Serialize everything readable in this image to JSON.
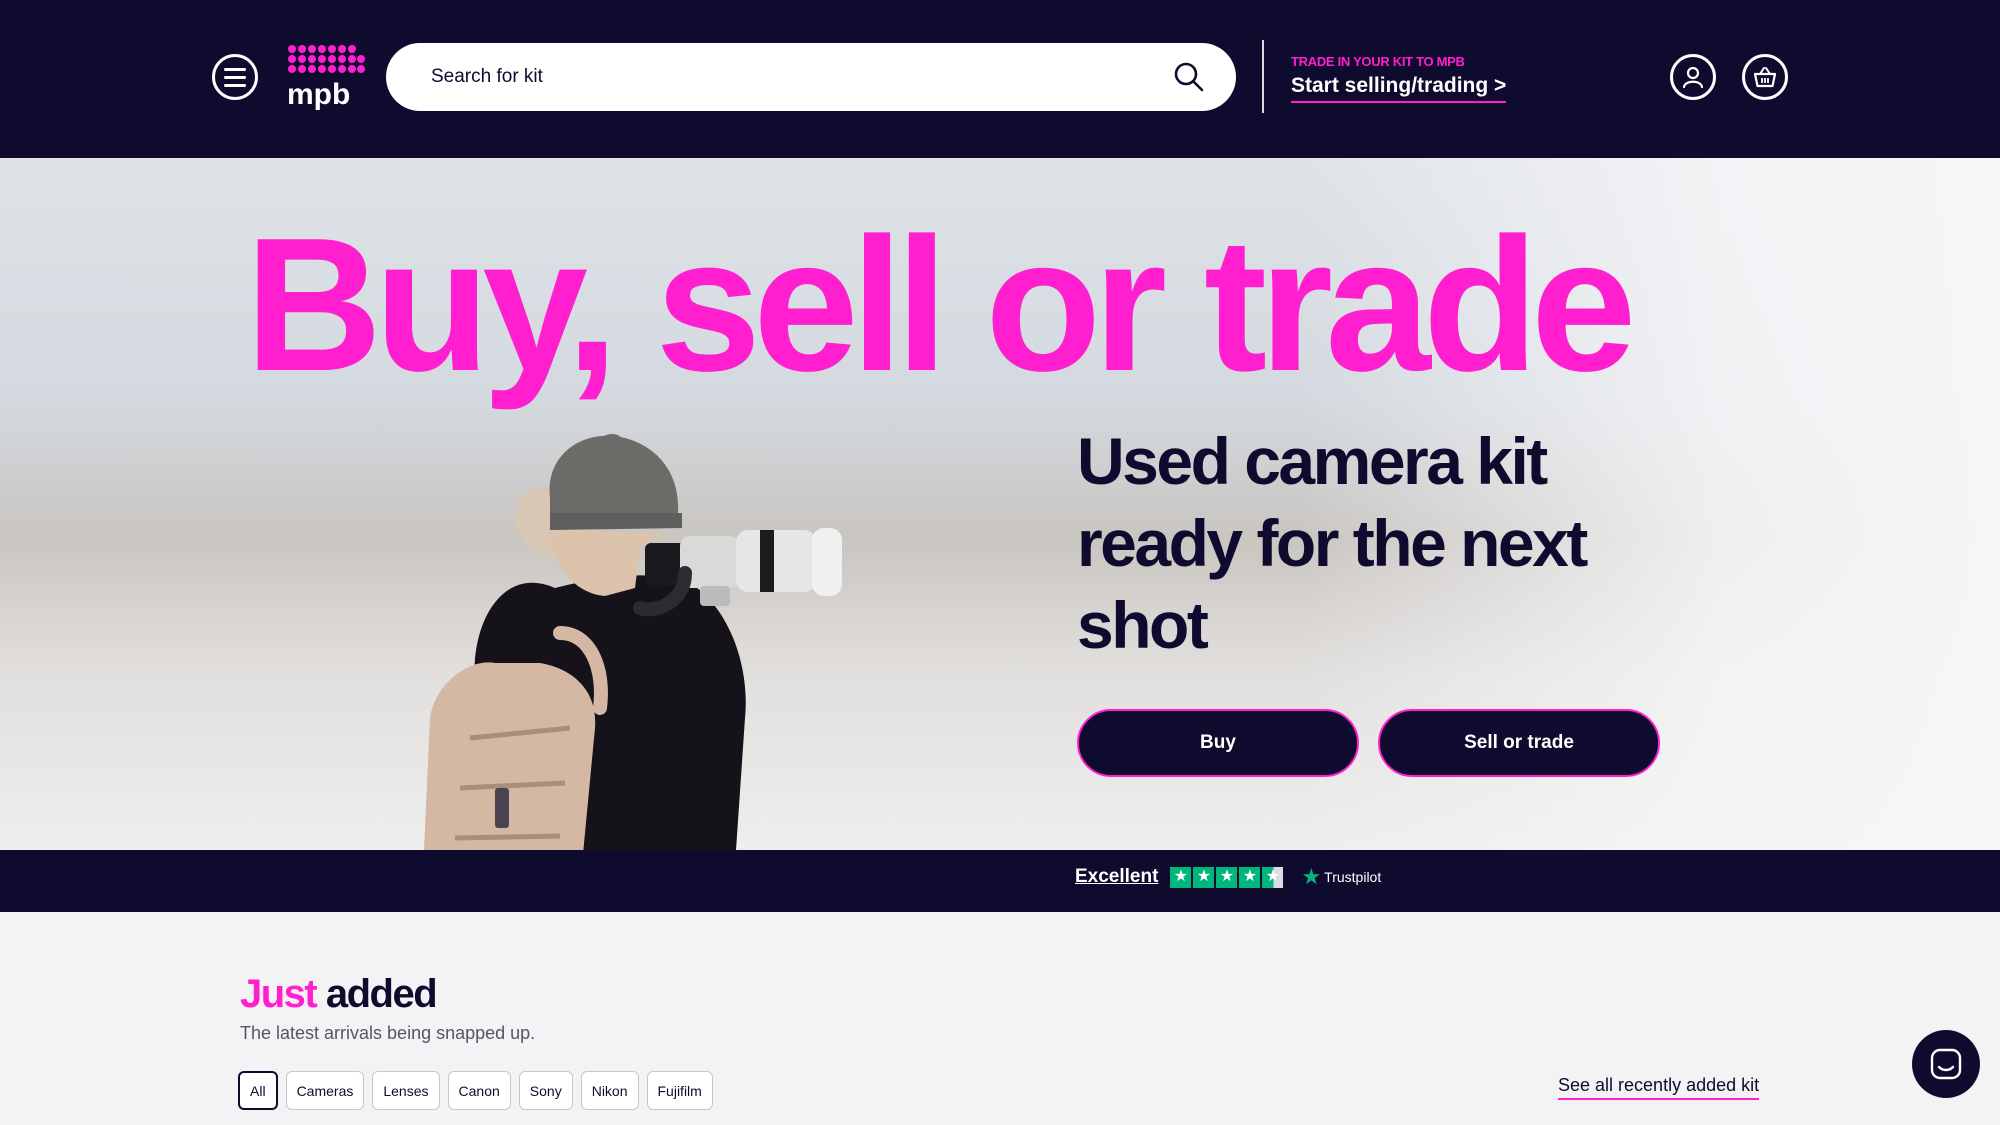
{
  "header": {
    "search_placeholder": "Search for kit",
    "trade_kicker": "TRADE IN YOUR KIT TO MPB",
    "trade_link": "Start selling/trading >",
    "logo_text": "mpb"
  },
  "hero": {
    "title": "Buy, sell or trade",
    "subtitle": "Used camera kit ready for the next shot",
    "buy_label": "Buy",
    "sell_label": "Sell or trade"
  },
  "trust": {
    "rating_label": "Excellent",
    "stars_filled": 4.5,
    "stars_max": 5,
    "brand": "Trustpilot"
  },
  "just_added": {
    "title_accent": "Just",
    "title_rest": "added",
    "subtitle": "The latest arrivals being snapped up.",
    "filters": [
      "All",
      "Cameras",
      "Lenses",
      "Canon",
      "Sony",
      "Nikon",
      "Fujifilm"
    ],
    "active_filter": "All",
    "see_all": "See all recently added kit"
  },
  "colors": {
    "navy": "#0f0b2e",
    "brand_pink": "#ff1fcf",
    "trustpilot_green": "#00b67a"
  },
  "icons": [
    "menu-icon",
    "mpb-logo",
    "search-icon",
    "account-icon",
    "basket-icon",
    "trustpilot-star-icon",
    "chat-icon"
  ]
}
